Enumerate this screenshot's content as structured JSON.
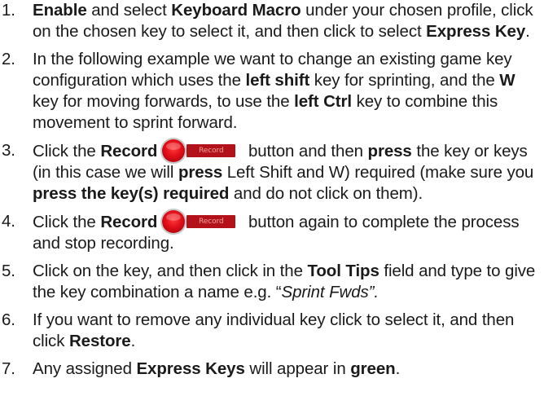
{
  "steps": [
    {
      "num": "1.",
      "parts": [
        "",
        "Enable",
        " and select ",
        "Keyboard Macro",
        " under your chosen profile, click on the chosen key to select it, and then click to select ",
        "Express Key",
        "."
      ]
    },
    {
      "num": "2.",
      "parts": [
        "In the following example we want to change an existing game key configuration which uses the ",
        "left shift",
        " key for sprinting, and the ",
        "W",
        " key for moving forwards, to use the ",
        "left Ctrl",
        " key to combine this movement to sprint forward."
      ]
    },
    {
      "num": "3.",
      "t1": "Click the ",
      "b1": "Record",
      "t2": " button and then ",
      "b2": "press",
      "t3": " the key or keys (in this case we will ",
      "b3": "press",
      "t4": " Left Shift and W) required (make sure you ",
      "b4": "press the key(s) required",
      "t5": " and do not click on them)."
    },
    {
      "num": "4.",
      "t1": "Click the ",
      "b1": "Record",
      "t2": " button again to complete the process and stop recording."
    },
    {
      "num": "5.",
      "t1": "Click on the key, and then click in the ",
      "b1": "Tool Tips",
      "t2": " field and type to give the key combination a name e.g. “",
      "i1": "Sprint Fwds”."
    },
    {
      "num": "6.",
      "t1": "If you want to remove any individual key click to select it, and then click ",
      "b1": "Restore",
      "t2": "."
    },
    {
      "num": "7.",
      "t1": "Any assigned ",
      "b1": "Express Keys",
      "t2": " will appear in ",
      "b2": "green",
      "t3": "."
    }
  ],
  "record_button": {
    "label": "Record",
    "icon": "record-icon",
    "circle_color": "#e10f1a",
    "bar_color": "#b3121b"
  }
}
